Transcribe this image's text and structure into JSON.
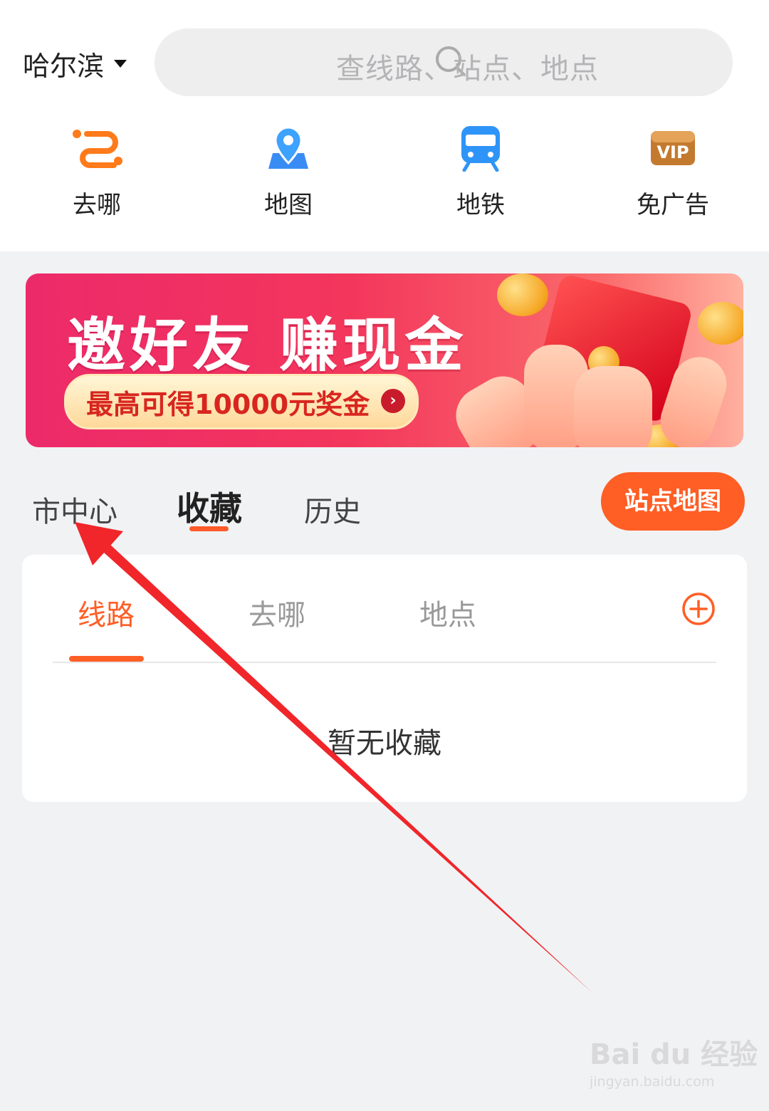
{
  "header": {
    "city": "哈尔滨",
    "search_placeholder": "查线路、站点、地点"
  },
  "quick_actions": [
    {
      "label": "去哪",
      "icon": "route-icon"
    },
    {
      "label": "地图",
      "icon": "map-pin-icon"
    },
    {
      "label": "地铁",
      "icon": "subway-icon"
    },
    {
      "label": "免广告",
      "icon": "vip-icon"
    }
  ],
  "banner": {
    "title": "邀好友 赚现金",
    "subtitle": "最高可得10000元奖金"
  },
  "top_tabs": {
    "items": [
      "市中心",
      "收藏",
      "历史"
    ],
    "active": "收藏",
    "station_map_button": "站点地图"
  },
  "favorites": {
    "tabs": [
      "线路",
      "去哪",
      "地点"
    ],
    "active": "线路",
    "empty_text": "暂无收藏"
  },
  "colors": {
    "accent": "#ff5e25",
    "background": "#f1f2f4"
  },
  "watermark": {
    "brand": "Bai du 经验",
    "url": "jingyan.baidu.com"
  }
}
